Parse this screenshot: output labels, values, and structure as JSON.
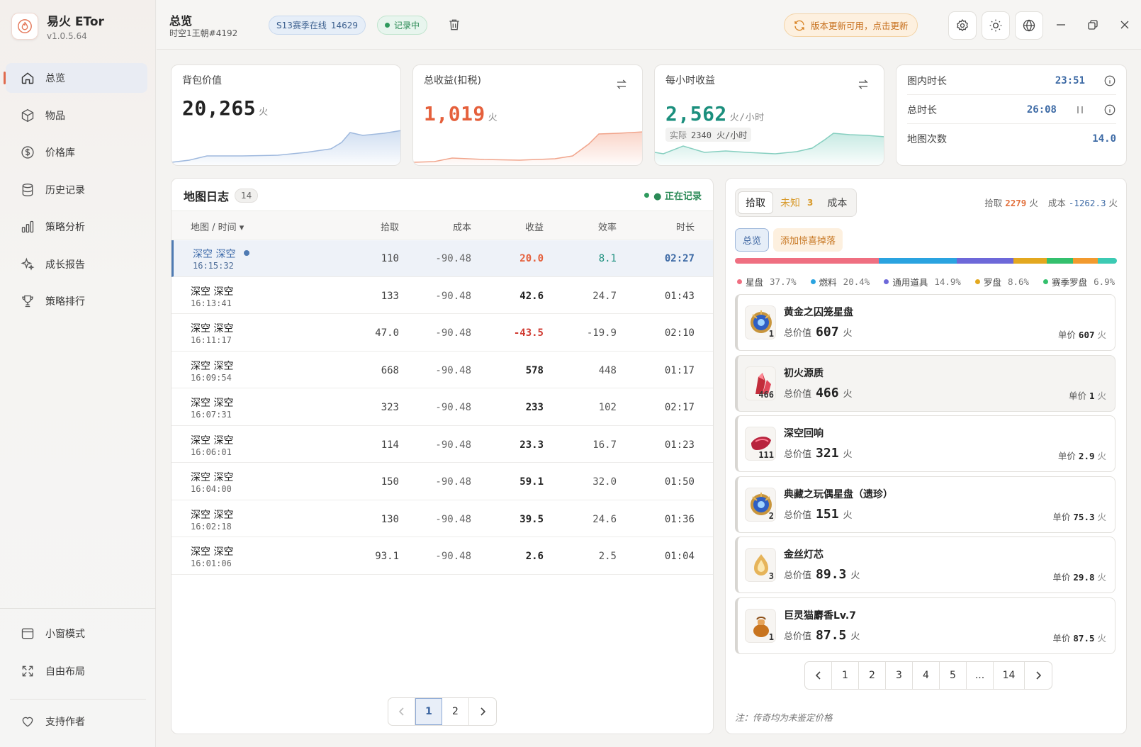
{
  "app": {
    "name": "易火 ETor",
    "version": "v1.0.5.64"
  },
  "nav": {
    "items": [
      {
        "label": "总览",
        "icon": "home-icon",
        "active": true
      },
      {
        "label": "物品",
        "icon": "cube-icon"
      },
      {
        "label": "价格库",
        "icon": "dollar-icon"
      },
      {
        "label": "历史记录",
        "icon": "database-icon"
      },
      {
        "label": "策略分析",
        "icon": "bar-chart-icon"
      },
      {
        "label": "成长报告",
        "icon": "sparkle-icon"
      },
      {
        "label": "策略排行",
        "icon": "trophy-icon"
      }
    ],
    "bottom": [
      {
        "label": "小窗模式",
        "icon": "window-icon"
      },
      {
        "label": "自由布局",
        "icon": "expand-icon"
      },
      {
        "label": "支持作者",
        "icon": "heart-icon"
      }
    ]
  },
  "header": {
    "title": "总览",
    "subtitle": "时空1王朝#4192",
    "season_label": "S13赛季在线",
    "season_count": "14629",
    "recording_label": "记录中",
    "update_label": "版本更新可用，点击更新"
  },
  "stats": {
    "bag": {
      "label": "背包价值",
      "value": "20,265",
      "unit": "火"
    },
    "total": {
      "label": "总收益(扣税)",
      "value": "1,019",
      "unit": "火"
    },
    "hourly": {
      "label": "每小时收益",
      "value": "2,562",
      "unit": "火/小时",
      "actual_label": "实际",
      "actual_value": "2340 火/小时"
    },
    "times": [
      {
        "label": "图内时长",
        "value": "23:51"
      },
      {
        "label": "总时长",
        "value": "26:08"
      },
      {
        "label": "地图次数",
        "value": "14.0"
      }
    ]
  },
  "maplog": {
    "title": "地图日志",
    "count": "14",
    "recording": "● 正在记录",
    "columns": [
      "地图 / 时间 ▾",
      "拾取",
      "成本",
      "收益",
      "效率",
      "时长"
    ],
    "rows": [
      {
        "name": "深空 深空",
        "time": "16:15:32",
        "pick": "110",
        "cost": "-90.48",
        "profit": "20.0",
        "eff": "8.1",
        "dur": "02:27"
      },
      {
        "name": "深空 深空",
        "time": "16:13:41",
        "pick": "133",
        "cost": "-90.48",
        "profit": "42.6",
        "eff": "24.7",
        "dur": "01:43"
      },
      {
        "name": "深空 深空",
        "time": "16:11:17",
        "pick": "47.0",
        "cost": "-90.48",
        "profit": "-43.5",
        "eff": "-19.9",
        "dur": "02:10"
      },
      {
        "name": "深空 深空",
        "time": "16:09:54",
        "pick": "668",
        "cost": "-90.48",
        "profit": "578",
        "eff": "448",
        "dur": "01:17"
      },
      {
        "name": "深空 深空",
        "time": "16:07:31",
        "pick": "323",
        "cost": "-90.48",
        "profit": "233",
        "eff": "102",
        "dur": "02:17"
      },
      {
        "name": "深空 深空",
        "time": "16:06:01",
        "pick": "114",
        "cost": "-90.48",
        "profit": "23.3",
        "eff": "16.7",
        "dur": "01:23"
      },
      {
        "name": "深空 深空",
        "time": "16:04:00",
        "pick": "150",
        "cost": "-90.48",
        "profit": "59.1",
        "eff": "32.0",
        "dur": "01:50"
      },
      {
        "name": "深空 深空",
        "time": "16:02:18",
        "pick": "130",
        "cost": "-90.48",
        "profit": "39.5",
        "eff": "24.6",
        "dur": "01:36"
      },
      {
        "name": "深空 深空",
        "time": "16:01:06",
        "pick": "93.1",
        "cost": "-90.48",
        "profit": "2.6",
        "eff": "2.5",
        "dur": "01:04"
      }
    ],
    "pager": [
      "1",
      "2"
    ]
  },
  "drops": {
    "tabs": {
      "pick": "拾取",
      "unknown": "未知",
      "unknown_count": "3",
      "cost": "成本"
    },
    "summary": {
      "pick_label": "拾取",
      "pick_value": "2279",
      "pick_unit": "火",
      "cost_label": "成本",
      "cost_value": "-1262.3",
      "cost_unit": "火"
    },
    "subtabs": {
      "overview": "总览",
      "add": "添加惊喜掉落"
    },
    "categories": [
      {
        "name": "星盘",
        "pct": "37.7%",
        "color": "#ef6f81"
      },
      {
        "name": "燃料",
        "pct": "20.4%",
        "color": "#2aa3e0"
      },
      {
        "name": "通用道具",
        "pct": "14.9%",
        "color": "#6d68d9"
      },
      {
        "name": "罗盘",
        "pct": "8.6%",
        "color": "#e3a81f"
      },
      {
        "name": "赛季罗盘",
        "pct": "6.9%",
        "color": "#34c06d"
      }
    ],
    "bar_tail": [
      {
        "pct": 6.5,
        "color": "#f29a2e"
      },
      {
        "pct": 5.0,
        "color": "#3ccab3"
      }
    ],
    "total_label": "总价值",
    "unit_label": "单价",
    "currency": "火",
    "items": [
      {
        "name": "黄金之囚笼星盘",
        "qty": "1",
        "total": "607",
        "unit": "607",
        "icon": "astrolabe-icon",
        "color": "#2f5fc4"
      },
      {
        "name": "初火源质",
        "qty": "466",
        "total": "466",
        "unit": "1",
        "icon": "red-crystal-icon",
        "color": "#c22d3b"
      },
      {
        "name": "深空回响",
        "qty": "111",
        "total": "321",
        "unit": "2.9",
        "icon": "crimson-shard-icon",
        "color": "#b8233d"
      },
      {
        "name": "典藏之玩偶星盘（遗珍）",
        "qty": "2",
        "total": "151",
        "unit": "75.3",
        "icon": "astrolabe-icon",
        "color": "#2f5fc4"
      },
      {
        "name": "金丝灯芯",
        "qty": "3",
        "total": "89.3",
        "unit": "29.8",
        "icon": "golden-wick-icon",
        "color": "#e6b45a"
      },
      {
        "name": "巨灵猫麝香Lv.7",
        "qty": "1",
        "total": "87.5",
        "unit": "87.5",
        "icon": "musk-jar-icon",
        "color": "#c8741f"
      }
    ],
    "pager": [
      "1",
      "2",
      "3",
      "4",
      "5",
      "...",
      "14"
    ],
    "note": "注：传奇均为未鉴定价格"
  }
}
